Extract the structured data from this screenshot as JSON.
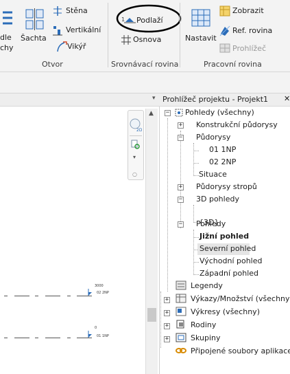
{
  "ribbon": {
    "otvor_panel": {
      "left_cut_top": "dle",
      "left_cut_bottom": "chy",
      "sachta": "Šachta",
      "stena": "Stěna",
      "vertikalni": "Vertikální",
      "vikyr": "Vikýř",
      "label": "Otvor"
    },
    "srovnavaci_panel": {
      "podlazi": "Podlaží",
      "osnova": "Osnova",
      "label": "Srovnávací rovina"
    },
    "pracovni_panel": {
      "nastavit": "Nastavit",
      "zobrazit": "Zobrazit",
      "ref_rovina": "Ref. rovina",
      "prohlizec": "Prohlížeč",
      "label": "Pracovní rovina"
    }
  },
  "canvas": {
    "levels": [
      {
        "elevation": "3000",
        "name": "02 2NP"
      },
      {
        "elevation": "0",
        "name": "01 1NP"
      }
    ]
  },
  "project_browser": {
    "title": "Prohlížeč projektu - Projekt1",
    "close": "✕",
    "tree": {
      "root": "Pohledy (všechny)",
      "konstrukcni": "Konstrukční půdorysy",
      "pudorysy": "Půdorysy",
      "np1": "01 1NP",
      "np2": "02 2NP",
      "situace": "Situace",
      "pudorysy_stropu": "Půdorysy stropů",
      "pohledy_3d": "3D pohledy",
      "view_3d": "{3D}",
      "pohledy": "Pohledy",
      "jizni": "Jižní pohled",
      "severni": "Severní pohled",
      "vychodni": "Východní pohled",
      "zapadni": "Západní pohled",
      "legendy": "Legendy",
      "vykazy": "Výkazy/Množství (všechny)",
      "vykresy": "Výkresy (všechny)",
      "rodiny": "Rodiny",
      "skupiny": "Skupiny",
      "pripojene": "Připojené soubory aplikace"
    }
  },
  "colors": {
    "accent_blue": "#2b6cb8",
    "highlight_circle": "#000000",
    "selected_row": "#e5e5e5"
  }
}
